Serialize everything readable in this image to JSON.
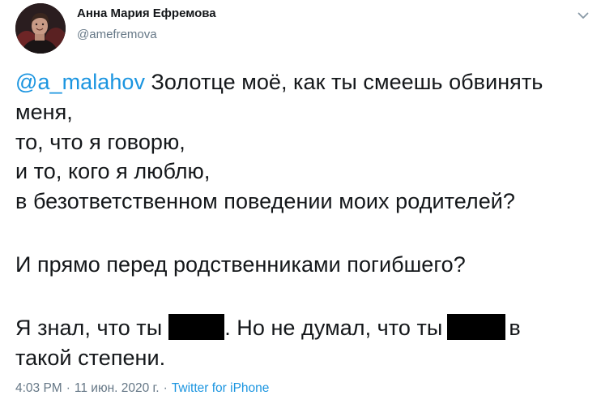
{
  "author": {
    "display_name": "Анна Мария Ефремова",
    "handle": "@amefremova"
  },
  "icons": {
    "menu": "chevron-down-icon",
    "avatar": "profile-photo"
  },
  "colors": {
    "link": "#1b95e0",
    "secondary_text": "#657786",
    "primary_text": "#14171a",
    "redaction": "#000000"
  },
  "tweet": {
    "mention": "@a_malahov",
    "line1_text": " Золотце моё, как ты смеешь обвинять",
    "line2": "меня,",
    "line3": "то, что я говорю,",
    "line4": "и то, кого я люблю,",
    "line5": "в безответственном поведении моих родителей?",
    "line6": "И прямо перед родственниками погибшего?",
    "line7_part1": "Я знал, что ты",
    "line7_part2": ". Но не думал, что ты",
    "line7_part3": "в",
    "line8": "такой степени."
  },
  "meta": {
    "time": "4:03 PM",
    "separator": "·",
    "date": "11 июн. 2020 г.",
    "source": "Twitter for iPhone"
  }
}
